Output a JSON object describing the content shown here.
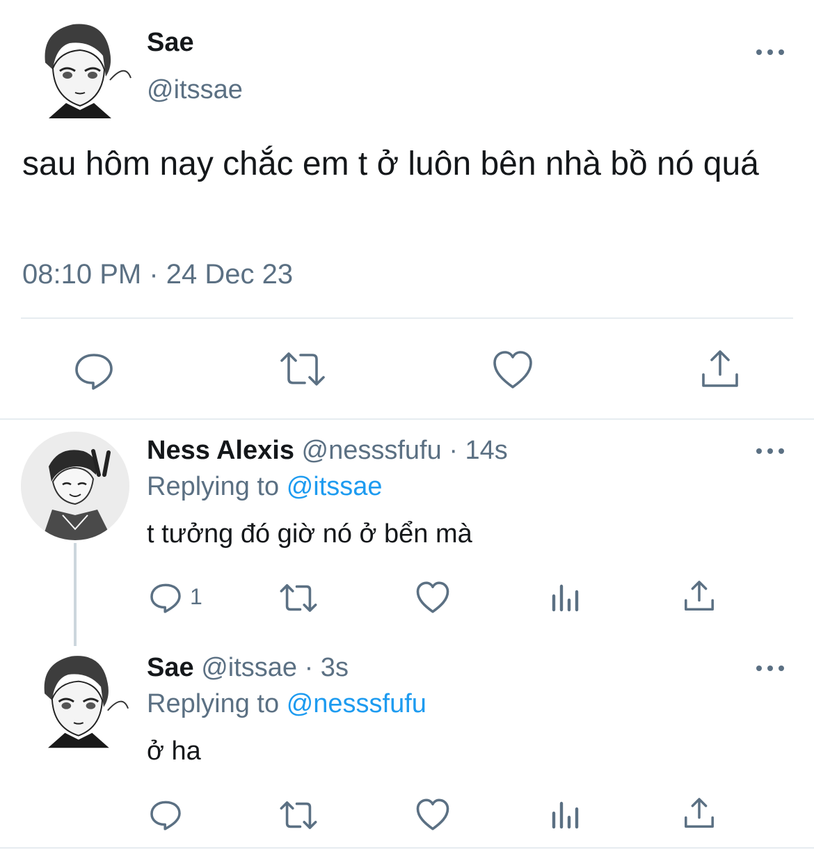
{
  "main_tweet": {
    "author_name": "Sae",
    "author_handle": "@itssae",
    "text": "sau hôm nay chắc em t ở luôn bên nhà bồ nó quá",
    "timestamp": "08:10 PM · 24 Dec 23",
    "actions": [
      "reply-icon",
      "retweet-icon",
      "like-icon",
      "share-icon"
    ]
  },
  "replies": [
    {
      "author_name": "Ness Alexis",
      "author_handle": "@nesssfufu",
      "time": "· 14s",
      "replying_label": "Replying to",
      "replying_to": "@itssae",
      "text": "t tưởng đó giờ nó ở bển mà",
      "reply_count": "1",
      "actions": [
        "reply-icon",
        "retweet-icon",
        "like-icon",
        "analytics-icon",
        "share-icon"
      ]
    },
    {
      "author_name": "Sae",
      "author_handle": "@itssae",
      "time": "· 3s",
      "replying_label": "Replying to",
      "replying_to": "@nesssfufu",
      "text": "ở ha",
      "reply_count": "",
      "actions": [
        "reply-icon",
        "retweet-icon",
        "like-icon",
        "analytics-icon",
        "share-icon"
      ]
    }
  ],
  "colors": {
    "text": "#14171a",
    "muted": "#5b7083",
    "link": "#1d9bf0",
    "divider": "#e6ecf0"
  }
}
